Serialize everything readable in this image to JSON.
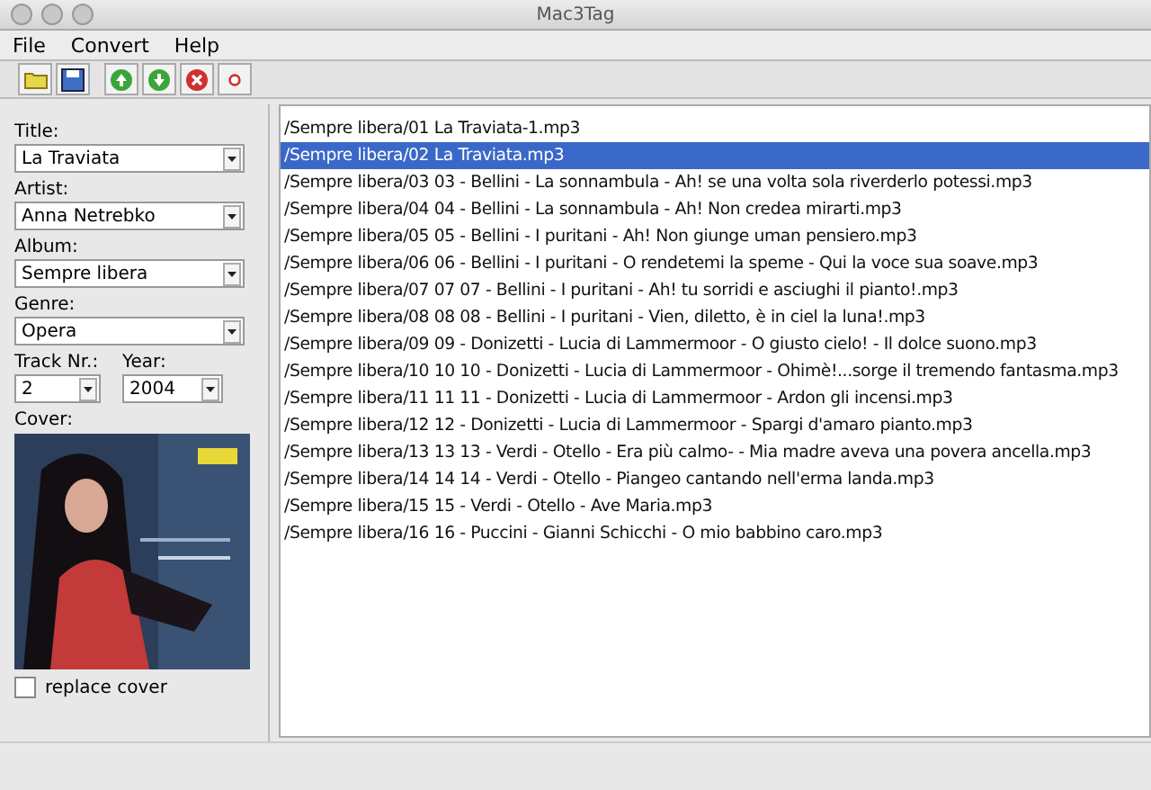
{
  "window": {
    "title": "Mac3Tag"
  },
  "menu": [
    "File",
    "Convert",
    "Help"
  ],
  "toolbar": [
    {
      "kind": "open"
    },
    {
      "kind": "save"
    },
    {
      "kind": "up"
    },
    {
      "kind": "down"
    },
    {
      "kind": "remove"
    },
    {
      "kind": "clear"
    }
  ],
  "fields": [
    {
      "label": "Title:",
      "value": "La Traviata"
    },
    {
      "label": "Artist:",
      "value": "Anna Netrebko"
    },
    {
      "label": "Album:",
      "value": "Sempre libera"
    },
    {
      "label": "Genre:",
      "value": "Opera"
    }
  ],
  "track": {
    "label": "Track Nr.:",
    "value": "2"
  },
  "year": {
    "label": "Year:",
    "value": "2004"
  },
  "cover": {
    "label": "Cover:",
    "kind": "picture"
  },
  "replace_cover": {
    "label": "replace cover",
    "checked": false
  },
  "files": [
    {
      "name": "/Sempre libera/01 La Traviata-1.mp3",
      "selected": false
    },
    {
      "name": "/Sempre libera/02 La Traviata.mp3",
      "selected": true
    },
    {
      "name": "/Sempre libera/03 03 - Bellini - La sonnambula - Ah! se una volta sola riverderlo potessi.mp3",
      "selected": false
    },
    {
      "name": "/Sempre libera/04 04 - Bellini - La sonnambula - Ah! Non credea mirarti.mp3",
      "selected": false
    },
    {
      "name": "/Sempre libera/05 05 - Bellini - I puritani - Ah! Non giunge uman pensiero.mp3",
      "selected": false
    },
    {
      "name": "/Sempre libera/06 06 - Bellini - I puritani - O rendetemi la speme - Qui la voce sua soave.mp3",
      "selected": false
    },
    {
      "name": "/Sempre libera/07 07 07 - Bellini - I puritani - Ah! tu sorridi e asciughi il pianto!.mp3",
      "selected": false
    },
    {
      "name": "/Sempre libera/08 08 08 - Bellini - I puritani - Vien, diletto, è in ciel la luna!.mp3",
      "selected": false
    },
    {
      "name": "/Sempre libera/09 09 - Donizetti - Lucia di Lammermoor - O giusto cielo! - Il dolce suono.mp3",
      "selected": false
    },
    {
      "name": "/Sempre libera/10 10 10 - Donizetti - Lucia di Lammermoor - Ohimè!...sorge il tremendo fantasma.mp3",
      "selected": false
    },
    {
      "name": "/Sempre libera/11 11 11 - Donizetti - Lucia di Lammermoor - Ardon gli incensi.mp3",
      "selected": false
    },
    {
      "name": "/Sempre libera/12 12 - Donizetti - Lucia di Lammermoor - Spargi d'amaro pianto.mp3",
      "selected": false
    },
    {
      "name": "/Sempre libera/13 13 13 - Verdi - Otello - Era più calmo- - Mia madre aveva una povera ancella.mp3",
      "selected": false
    },
    {
      "name": "/Sempre libera/14 14 14 - Verdi - Otello - Piangeo cantando nell'erma landa.mp3",
      "selected": false
    },
    {
      "name": "/Sempre libera/15 15 - Verdi - Otello - Ave Maria.mp3",
      "selected": false
    },
    {
      "name": "/Sempre libera/16 16 - Puccini - Gianni Schicchi - O mio babbino caro.mp3",
      "selected": false
    }
  ]
}
